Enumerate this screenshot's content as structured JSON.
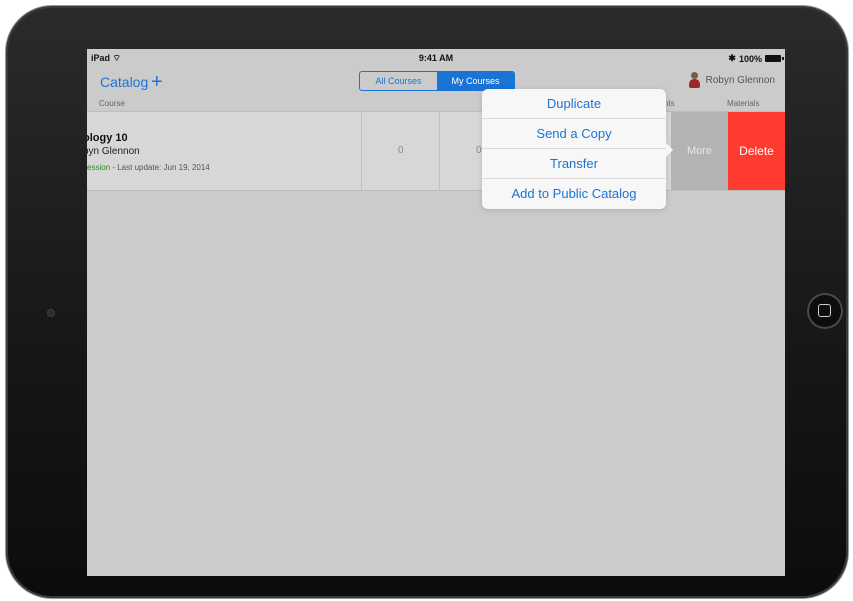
{
  "status_bar": {
    "device": "iPad",
    "time": "9:41 AM",
    "battery": "100%"
  },
  "nav": {
    "title": "Catalog",
    "add_symbol": "+",
    "tabs": [
      {
        "label": "All Courses",
        "active": false
      },
      {
        "label": "My Courses",
        "active": true
      }
    ],
    "user_name": "Robyn Glennon"
  },
  "columns": {
    "course": "Course",
    "students": "dents",
    "materials": "Materials"
  },
  "course_row": {
    "title": "ology 10",
    "author": "byn Glennon",
    "status": "session",
    "meta": " - Last update: Jun 19, 2014",
    "count_1": "0",
    "count_2": "0",
    "more_label": "More",
    "delete_label": "Delete"
  },
  "popover_menu": {
    "items": [
      "Duplicate",
      "Send a Copy",
      "Transfer",
      "Add to Public Catalog"
    ]
  },
  "colors": {
    "accent": "#1a74d6",
    "delete": "#ff3a30",
    "more": "#b3b3b3",
    "status_green": "#2a8a2a"
  }
}
